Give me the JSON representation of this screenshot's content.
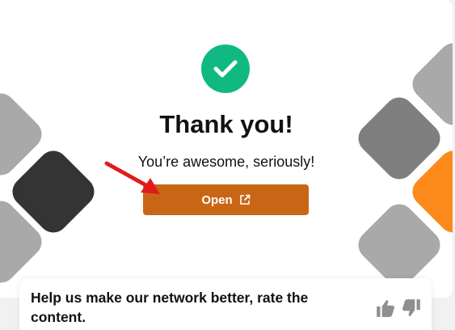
{
  "modal": {
    "title": "Thank you!",
    "subtitle": "You’re awesome, seriously!",
    "open_button_label": "Open",
    "success_icon": "check-icon",
    "open_icon": "external-link-icon"
  },
  "feedback": {
    "prompt": "Help us make our network better, rate the content.",
    "like_icon": "thumbs-up-icon",
    "dislike_icon": "thumbs-down-icon"
  },
  "colors": {
    "success": "#10b981",
    "button": "#c96616",
    "accent_orange": "#fb8a1a",
    "annotation_arrow": "#e01b1b"
  }
}
